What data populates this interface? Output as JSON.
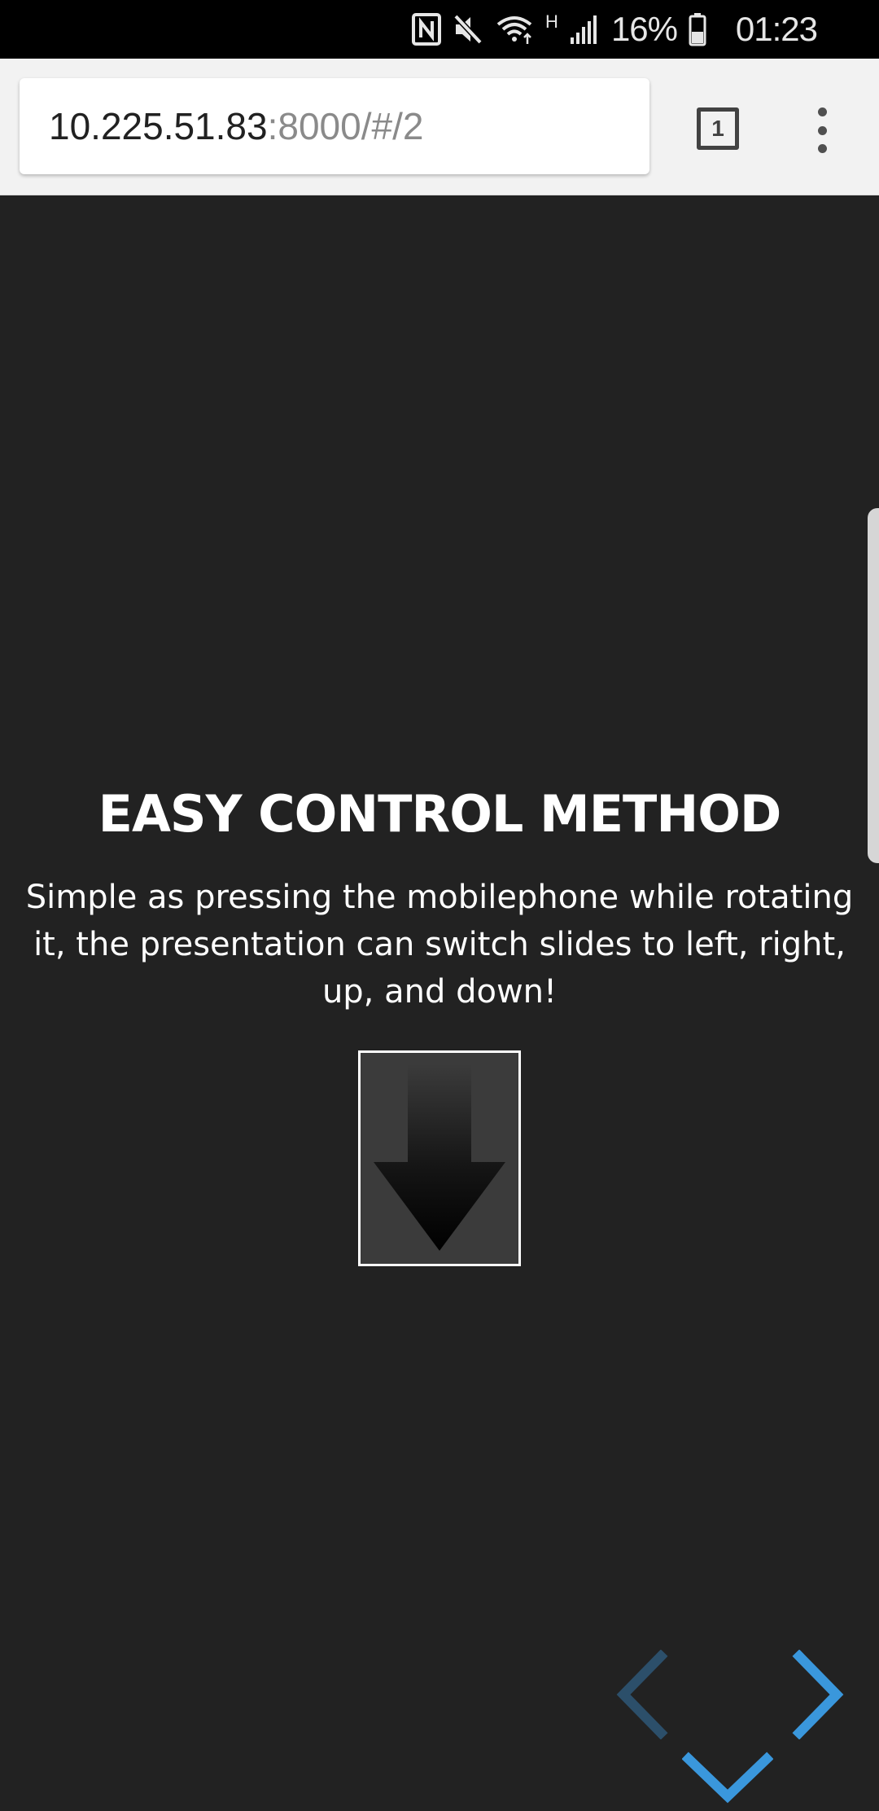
{
  "status_bar": {
    "battery_percent": "16%",
    "time": "01:23",
    "network_type": "H",
    "icons": [
      "nfc-icon",
      "mute-icon",
      "wifi-icon",
      "signal-icon",
      "battery-icon"
    ]
  },
  "browser": {
    "url_host": "10.225.51.83",
    "url_rest": ":8000/#/2",
    "tab_count": "1"
  },
  "slide": {
    "title": "EASY CONTROL METHOD",
    "text": "Simple as pressing the mobilephone while rotating it, the presentation can switch slides to left, right, up, and down!",
    "figure_icon": "down-arrow-icon"
  },
  "navigation": {
    "left": {
      "icon": "chevron-left-icon",
      "enabled": false
    },
    "right": {
      "icon": "chevron-right-icon",
      "enabled": true
    },
    "down": {
      "icon": "chevron-down-icon",
      "enabled": true
    },
    "accent_color": "#3a97dc",
    "disabled_color": "#2c4f6a"
  },
  "colors": {
    "background": "#222222",
    "text": "#ffffff",
    "status_bar": "#000000",
    "browser_bar": "#f2f2f2"
  }
}
